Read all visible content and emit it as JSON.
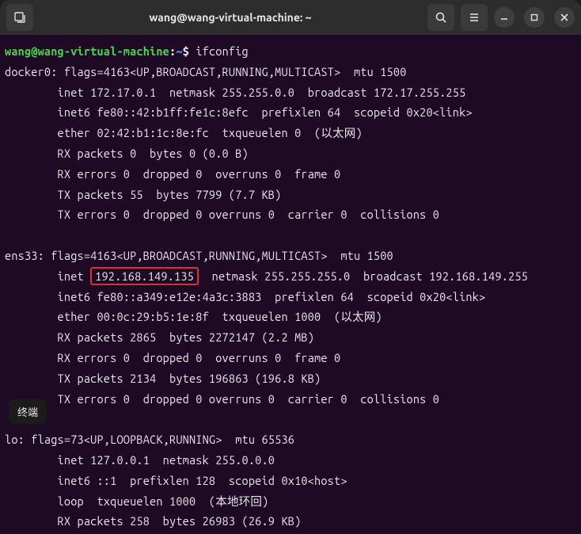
{
  "titlebar": {
    "title": "wang@wang-virtual-machine: ~"
  },
  "tooltip": "终端",
  "prompt": {
    "user_host": "wang@wang-virtual-machine",
    "colon": ":",
    "path": "~",
    "sigil": "$",
    "command": "ifconfig"
  },
  "iface": {
    "docker0": {
      "header": "docker0: flags=4163<UP,BROADCAST,RUNNING,MULTICAST>  mtu 1500",
      "inet": "        inet 172.17.0.1  netmask 255.255.0.0  broadcast 172.17.255.255",
      "inet6": "        inet6 fe80::42:b1ff:fe1c:8efc  prefixlen 64  scopeid 0x20<link>",
      "ether": "        ether 02:42:b1:1c:8e:fc  txqueuelen 0  (以太网)",
      "rx_packets": "        RX packets 0  bytes 0 (0.0 B)",
      "rx_errors": "        RX errors 0  dropped 0  overruns 0  frame 0",
      "tx_packets": "        TX packets 55  bytes 7799 (7.7 KB)",
      "tx_errors": "        TX errors 0  dropped 0 overruns 0  carrier 0  collisions 0"
    },
    "ens33": {
      "header": "ens33: flags=4163<UP,BROADCAST,RUNNING,MULTICAST>  mtu 1500",
      "inet_pre": "        inet ",
      "inet_ip": "192.168.149.135",
      "inet_post": "  netmask 255.255.255.0  broadcast 192.168.149.255",
      "inet6": "        inet6 fe80::a349:e12e:4a3c:3883  prefixlen 64  scopeid 0x20<link>",
      "ether": "        ether 00:0c:29:b5:1e:8f  txqueuelen 1000  (以太网)",
      "rx_packets": "        RX packets 2865  bytes 2272147 (2.2 MB)",
      "rx_errors": "        RX errors 0  dropped 0  overruns 0  frame 0",
      "tx_packets": "        TX packets 2134  bytes 196863 (196.8 KB)",
      "tx_errors": "        TX errors 0  dropped 0 overruns 0  carrier 0  collisions 0"
    },
    "lo": {
      "header": "lo: flags=73<UP,LOOPBACK,RUNNING>  mtu 65536",
      "inet": "        inet 127.0.0.1  netmask 255.0.0.0",
      "inet6": "        inet6 ::1  prefixlen 128  scopeid 0x10<host>",
      "loop": "        loop  txqueuelen 1000  (本地环回)",
      "rx_packets": "        RX packets 258  bytes 26983 (26.9 KB)"
    }
  }
}
